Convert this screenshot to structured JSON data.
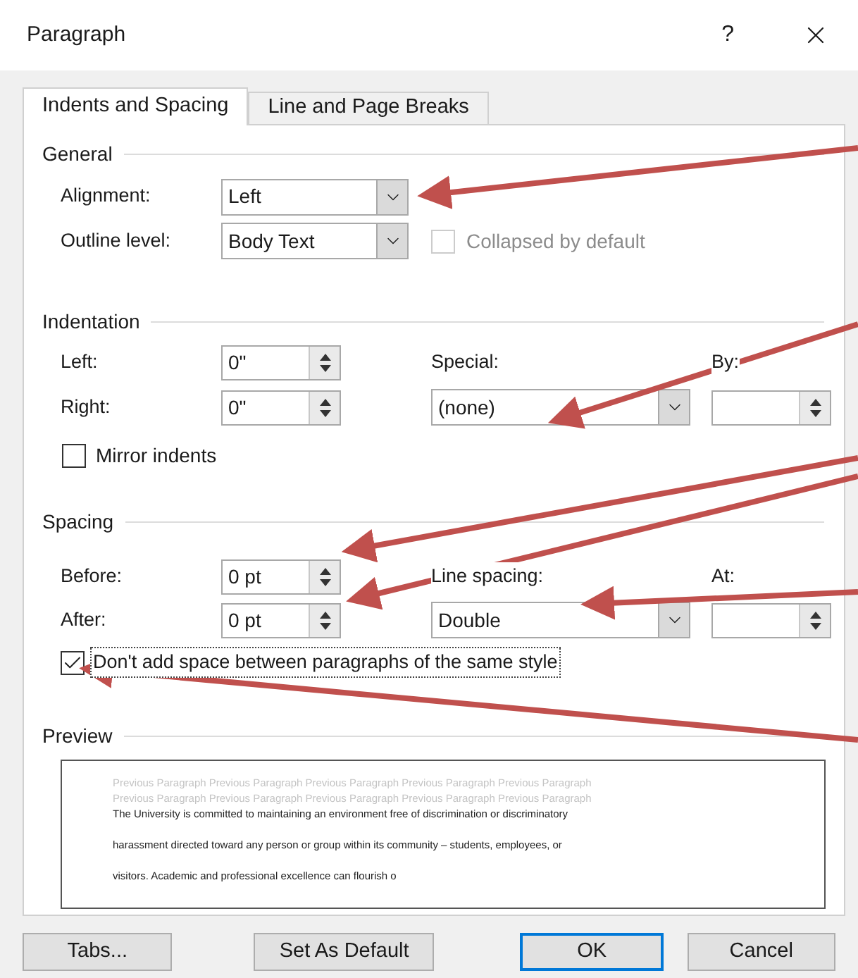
{
  "window": {
    "title": "Paragraph",
    "help": "?"
  },
  "tabs": [
    {
      "label": "Indents and Spacing",
      "selected": true
    },
    {
      "label": "Line and Page Breaks",
      "selected": false
    }
  ],
  "general": {
    "heading": "General",
    "alignment": {
      "label": "Alignment:",
      "value": "Left"
    },
    "outline_level": {
      "label": "Outline level:",
      "value": "Body Text"
    },
    "collapsed": {
      "label": "Collapsed by default",
      "checked": false,
      "disabled": true
    }
  },
  "indentation": {
    "heading": "Indentation",
    "left": {
      "label": "Left:",
      "value": "0\""
    },
    "right": {
      "label": "Right:",
      "value": "0\""
    },
    "special": {
      "label": "Special:",
      "value": "(none)"
    },
    "by": {
      "label": "By:"
    },
    "mirror": {
      "label": "Mirror indents",
      "checked": false
    }
  },
  "spacing": {
    "heading": "Spacing",
    "before": {
      "label": "Before:",
      "value": "0 pt"
    },
    "after": {
      "label": "After:",
      "value": "0 pt"
    },
    "line_spacing": {
      "label": "Line spacing:",
      "value": "Double"
    },
    "at": {
      "label": "At:"
    },
    "dont_add": {
      "label": "Don't add space between paragraphs of the same style",
      "checked": true
    }
  },
  "preview": {
    "heading": "Preview",
    "previous": [
      "Previous Paragraph Previous Paragraph Previous Paragraph Previous Paragraph Previous Paragraph",
      "Previous Paragraph Previous Paragraph Previous Paragraph Previous Paragraph Previous Paragraph"
    ],
    "sample": [
      "The University is committed to maintaining an environment free of discrimination or discriminatory",
      "harassment directed toward any person or group within its community – students, employees, or",
      "visitors.  Academic and professional excellence can flourish o"
    ]
  },
  "buttons": [
    {
      "label": "Tabs...",
      "default": false
    },
    {
      "label": "Set As Default",
      "default": false
    },
    {
      "label": "OK",
      "default": true
    },
    {
      "label": "Cancel",
      "default": false
    }
  ]
}
